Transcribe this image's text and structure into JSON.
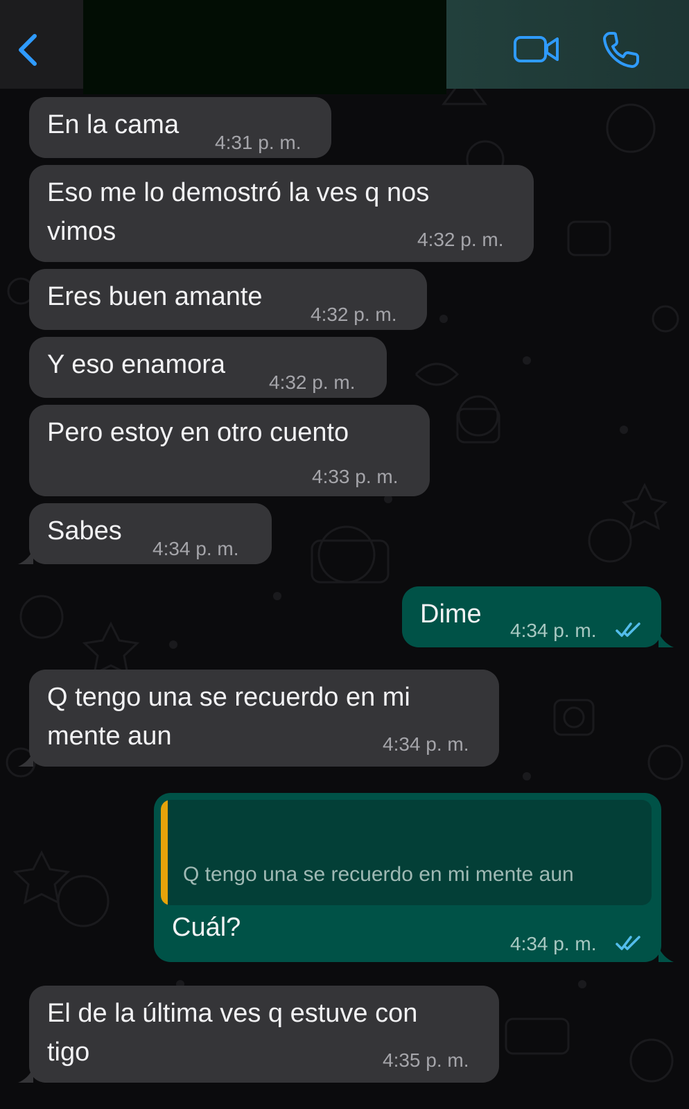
{
  "header": {
    "back_icon": "chevron-left-icon",
    "video_icon": "video-camera-icon",
    "call_icon": "phone-icon",
    "accent_color": "#2f9bff"
  },
  "messages": [
    {
      "direction": "in",
      "text": "En la cama",
      "time": "4:31 p. m."
    },
    {
      "direction": "in",
      "text": "Eso me lo demostró la ves q nos\nvimos",
      "time": "4:32 p. m."
    },
    {
      "direction": "in",
      "text": "Eres buen amante",
      "time": "4:32 p. m."
    },
    {
      "direction": "in",
      "text": "Y eso enamora",
      "time": "4:32 p. m."
    },
    {
      "direction": "in",
      "text": "Pero estoy en otro cuento",
      "time": "4:33 p. m."
    },
    {
      "direction": "in",
      "text": "Sabes",
      "time": "4:34 p. m."
    },
    {
      "direction": "out",
      "text": "Dime",
      "time": "4:34 p. m.",
      "status_icon": "double-check-read-icon"
    },
    {
      "direction": "in",
      "text": "Q tengo una se recuerdo en mi\nmente aun",
      "time": "4:34 p. m."
    },
    {
      "direction": "out",
      "quoted_text": "Q tengo una se recuerdo en mi mente aun",
      "text": "Cuál?",
      "time": "4:34 p. m.",
      "status_icon": "double-check-read-icon"
    },
    {
      "direction": "in",
      "text": "El de la última ves q estuve con\ntigo",
      "time": "4:35 p. m."
    }
  ],
  "colors": {
    "incoming_bubble": "#353538",
    "outgoing_bubble": "#005247",
    "read_ticks": "#53bdeb",
    "quote_bar": "#e6a30a"
  }
}
